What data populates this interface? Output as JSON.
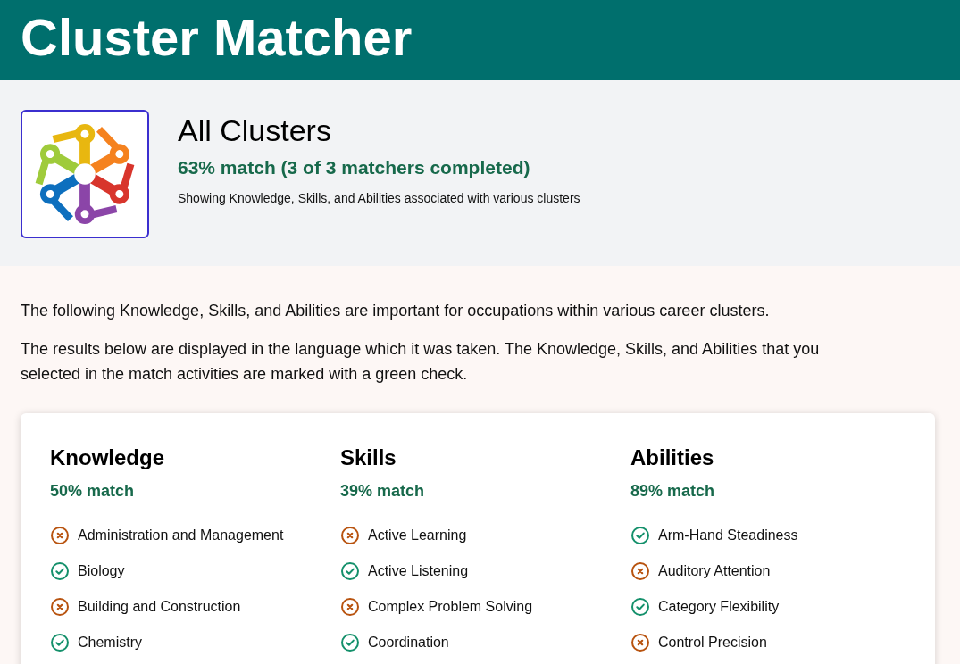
{
  "header": {
    "title": "Cluster Matcher"
  },
  "cluster": {
    "title": "All Clusters",
    "match": "63% match (3 of 3 matchers completed)",
    "description": "Showing Knowledge, Skills, and Abilities associated with various clusters"
  },
  "intro": [
    "The following Knowledge, Skills, and Abilities are important for occupations within various career clusters.",
    "The results below are displayed in the language which it was taken. The Knowledge, Skills, and Abilities that you selected in the match activities are marked with a green check."
  ],
  "categories": [
    {
      "title": "Knowledge",
      "match": "50% match",
      "items": [
        {
          "label": "Administration and Management",
          "selected": false
        },
        {
          "label": "Biology",
          "selected": true
        },
        {
          "label": "Building and Construction",
          "selected": false
        },
        {
          "label": "Chemistry",
          "selected": true
        }
      ]
    },
    {
      "title": "Skills",
      "match": "39% match",
      "items": [
        {
          "label": "Active Learning",
          "selected": false
        },
        {
          "label": "Active Listening",
          "selected": true
        },
        {
          "label": "Complex Problem Solving",
          "selected": false
        },
        {
          "label": "Coordination",
          "selected": true
        }
      ]
    },
    {
      "title": "Abilities",
      "match": "89% match",
      "items": [
        {
          "label": "Arm-Hand Steadiness",
          "selected": true
        },
        {
          "label": "Auditory Attention",
          "selected": false
        },
        {
          "label": "Category Flexibility",
          "selected": true
        },
        {
          "label": "Control Precision",
          "selected": false
        }
      ]
    }
  ]
}
